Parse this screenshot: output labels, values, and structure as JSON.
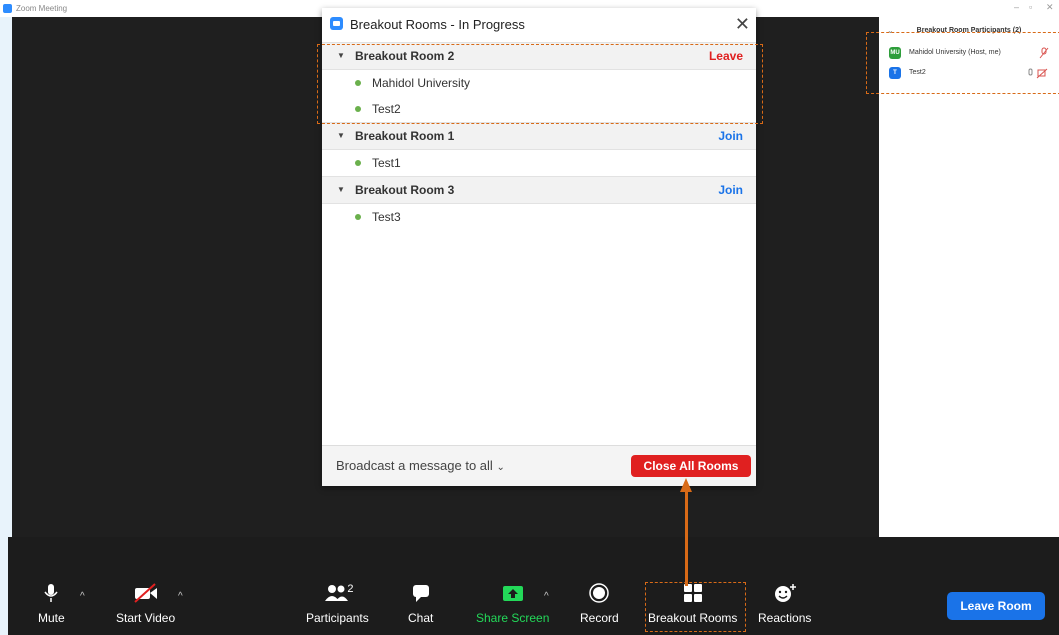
{
  "window": {
    "title": "Zoom Meeting"
  },
  "dialog": {
    "title": "Breakout Rooms - In Progress",
    "rooms": [
      {
        "name": "Breakout Room 2",
        "action": "Leave",
        "action_color": "#e02020",
        "members": [
          "Mahidol University",
          "Test2"
        ]
      },
      {
        "name": "Breakout Room 1",
        "action": "Join",
        "action_color": "#1a73e8",
        "members": [
          "Test1"
        ]
      },
      {
        "name": "Breakout Room 3",
        "action": "Join",
        "action_color": "#1a73e8",
        "members": [
          "Test3"
        ]
      }
    ],
    "broadcast_label": "Broadcast a message to all",
    "close_all_label": "Close All Rooms"
  },
  "side_panel": {
    "header": "Breakout Room Participants (2)",
    "participants": [
      {
        "initials": "MU",
        "name": "Mahidol University (Host, me)",
        "avatar_color": "#2e9e3b"
      },
      {
        "initials": "T",
        "name": "Test2",
        "avatar_color": "#1a73e8"
      }
    ]
  },
  "toolbar": {
    "mute": "Mute",
    "start_video": "Start Video",
    "participants": "Participants",
    "participants_count": "2",
    "chat": "Chat",
    "share_screen": "Share Screen",
    "record": "Record",
    "breakout_rooms": "Breakout Rooms",
    "reactions": "Reactions",
    "leave_room": "Leave Room"
  },
  "colors": {
    "accent": "#d86a17",
    "share_green": "#23d959",
    "danger": "#e02020",
    "primary": "#1a73e8"
  }
}
